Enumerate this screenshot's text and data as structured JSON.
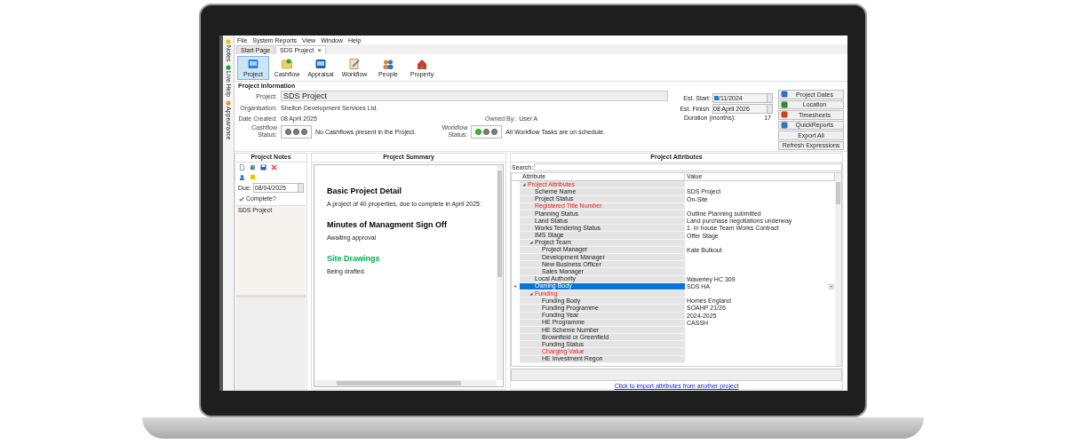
{
  "side_tabs": [
    {
      "kind": "notes",
      "label": "Notes"
    },
    {
      "kind": "help",
      "label": "Live Help"
    },
    {
      "kind": "appearance",
      "label": "Appearance"
    }
  ],
  "menu": [
    "File",
    "System Reports",
    "View",
    "Window",
    "Help"
  ],
  "tabs": [
    {
      "label": "Start Page",
      "selected": false,
      "closable": false
    },
    {
      "label": "SDS Project",
      "selected": true,
      "closable": true
    }
  ],
  "close_glyph": "×",
  "toolbar": [
    {
      "kind": "project",
      "label": "Project",
      "selected": true
    },
    {
      "kind": "cashflow",
      "label": "Cashflow",
      "selected": false
    },
    {
      "kind": "appraisal",
      "label": "Appraisal",
      "selected": false
    },
    {
      "kind": "workflow",
      "label": "Workflow",
      "selected": false
    },
    {
      "kind": "people",
      "label": "People",
      "selected": false
    },
    {
      "kind": "property",
      "label": "Property",
      "selected": false
    }
  ],
  "project_information": {
    "title": "Project Information",
    "project_label": "Project:",
    "project_value": "SDS Project",
    "organisation_label": "Organisation:",
    "organisation_value": "Shelton Development Services Ltd.",
    "date_created_label": "Date Created:",
    "date_created_value": "08 April 2025",
    "owned_by_label": "Owned By:",
    "owned_by_value": "User A",
    "statuses": [
      {
        "label": "Cashflow Status:",
        "lights": [
          {
            "on": false
          },
          {
            "on": false
          },
          {
            "on": false
          }
        ],
        "message": "No Cashflows present in the Project."
      },
      {
        "label": "Workflow Status:",
        "lights": [
          {
            "on": true
          },
          {
            "on": false
          },
          {
            "on": false
          }
        ],
        "message": "All Workflow Tasks are on schedule."
      }
    ],
    "est_start_label": "Est. Start:",
    "est_start_value": "/11/2024",
    "est_finish_label": "Est. Finish:",
    "est_finish_value": "08 April 2026",
    "duration_label": "Duration (months):",
    "duration_value": "17",
    "buttons": [
      {
        "kind": "dates",
        "label": "Project Dates"
      },
      {
        "kind": "location",
        "label": "Location"
      },
      {
        "kind": "timesheets",
        "label": "Timesheets"
      },
      {
        "kind": "reports",
        "label": "QuickReports"
      },
      {
        "kind": "plain",
        "label": "Export All"
      },
      {
        "kind": "plain",
        "label": "Refresh Expressions"
      }
    ]
  },
  "project_notes": {
    "title": "Project Notes",
    "due_label": "Due:",
    "due_value": "08/04/2025",
    "complete_label": "Complete?",
    "complete_checked": true,
    "list_header": "SDS Project"
  },
  "project_summary": {
    "title": "Project Summary",
    "sections": [
      {
        "heading": "Basic Project Detail",
        "color": "#000000",
        "text": "A project of 40 properties, due to complete in April 2025."
      },
      {
        "heading": "Minutes of Managment Sign Off",
        "color": "#000000",
        "text": "Awaiting approval"
      },
      {
        "heading": "Site Drawings",
        "color": "#00b050",
        "text": "Being drafted."
      }
    ]
  },
  "project_attributes": {
    "title": "Project Attributes",
    "search_label": "Search:",
    "columns": [
      "Attribute",
      "Value"
    ],
    "rows": [
      {
        "attribute": "Project Attributes",
        "required": true,
        "selected": false,
        "expanded": true,
        "children": [
          {
            "attribute": "Scheme Name",
            "value": "SDS Project",
            "required": false,
            "selected": false
          },
          {
            "attribute": "Project Status",
            "value": "On-Site",
            "required": false,
            "selected": false
          },
          {
            "attribute": "Registered Title Number",
            "required": true,
            "selected": false
          },
          {
            "attribute": "Planning Status",
            "value": "Outline Planning submitted",
            "required": false,
            "selected": false
          },
          {
            "attribute": "Land Status",
            "value": "Land purchase negotiations underway",
            "required": false,
            "selected": false
          },
          {
            "attribute": "Works Tendering Status",
            "value": "1. In house Team Works Contract",
            "required": false,
            "selected": false
          },
          {
            "attribute": "IMS Stage",
            "value": "Offer Stage",
            "required": false,
            "selected": false
          },
          {
            "attribute": "Project Team",
            "required": false,
            "selected": false,
            "expanded": true,
            "children": [
              {
                "attribute": "Project Manager",
                "value": "Kate Bulkout",
                "required": false,
                "selected": false
              },
              {
                "attribute": "Development Manager",
                "required": false,
                "selected": false
              },
              {
                "attribute": "New Business Officer",
                "required": false,
                "selected": false
              },
              {
                "attribute": "Sales Manager",
                "required": false,
                "selected": false
              }
            ]
          },
          {
            "attribute": "Local Authority",
            "value": "Waverley HC 309",
            "required": false,
            "selected": false
          },
          {
            "attribute": "Owning Body",
            "value": "SDS HA",
            "required": false,
            "selected": true
          },
          {
            "attribute": "Funding",
            "required": true,
            "selected": false,
            "expanded": true,
            "children": [
              {
                "attribute": "Funding Body",
                "value": "Homes England",
                "required": false,
                "selected": false
              },
              {
                "attribute": "Funding Programme",
                "value": "SOAHP 21/26",
                "required": false,
                "selected": false
              },
              {
                "attribute": "Funding Year",
                "value": "2024-2025",
                "required": false,
                "selected": false
              },
              {
                "attribute": "HE Programme",
                "value": "CASSH",
                "required": false,
                "selected": false
              },
              {
                "attribute": "HE Scheme Number",
                "required": false,
                "selected": false
              },
              {
                "attribute": "Brownfield or Greenfield",
                "required": false,
                "selected": false
              },
              {
                "attribute": "Funding Status",
                "required": false,
                "selected": false
              },
              {
                "attribute": "Charging Value",
                "required": true,
                "selected": false
              },
              {
                "attribute": "HE Investment Regon",
                "required": false,
                "selected": false
              }
            ]
          }
        ]
      }
    ],
    "import_link": "Click to import attributes from another project"
  }
}
